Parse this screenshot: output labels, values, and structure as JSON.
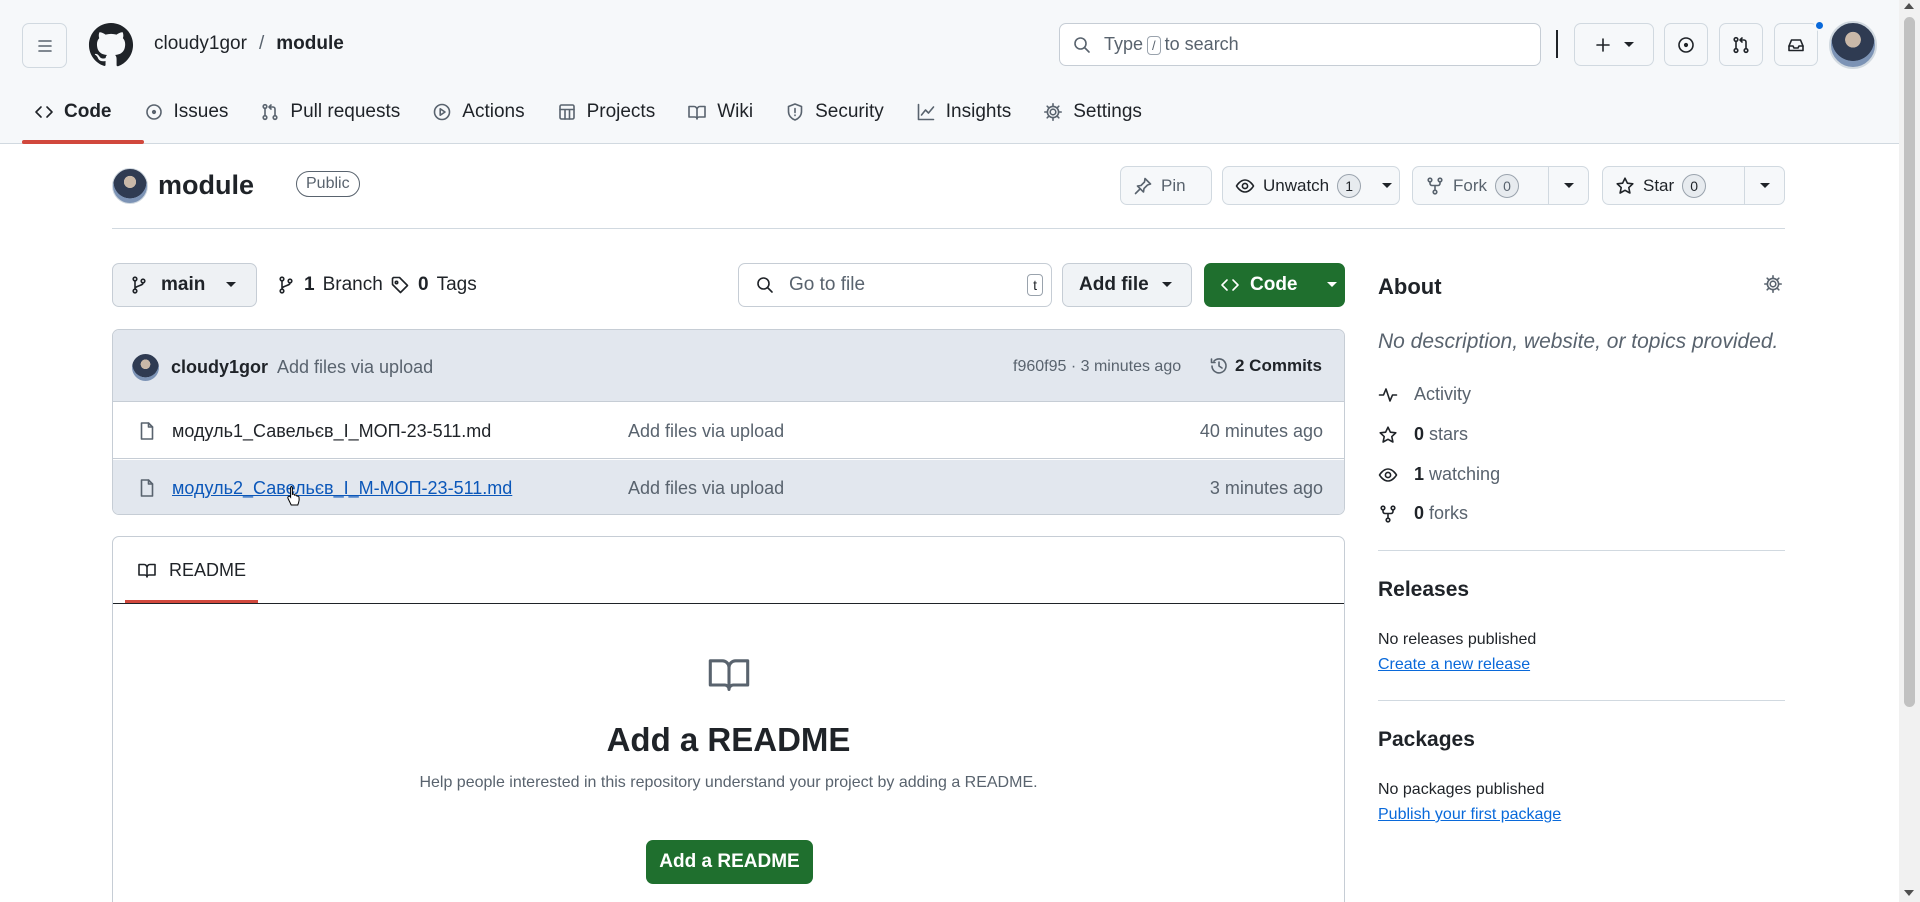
{
  "colors": {
    "accent": "#0969da",
    "primary_button": "#1f6f2e",
    "tab_underline": "#d1483d",
    "header_bg": "#f6f8fa"
  },
  "header": {
    "owner": "cloudy1gor",
    "separator": "/",
    "repo": "module",
    "search_placeholder_before": "Type",
    "search_slash": "/",
    "search_placeholder_after": "to search"
  },
  "tabs": [
    {
      "label": "Code",
      "icon": "code-icon",
      "selected": true
    },
    {
      "label": "Issues",
      "icon": "issue-icon"
    },
    {
      "label": "Pull requests",
      "icon": "pull-request-icon"
    },
    {
      "label": "Actions",
      "icon": "play-icon"
    },
    {
      "label": "Projects",
      "icon": "table-icon"
    },
    {
      "label": "Wiki",
      "icon": "book-icon"
    },
    {
      "label": "Security",
      "icon": "shield-icon"
    },
    {
      "label": "Insights",
      "icon": "graph-icon"
    },
    {
      "label": "Settings",
      "icon": "gear-icon"
    }
  ],
  "repo": {
    "name": "module",
    "visibility": "Public",
    "pin_label": "Pin",
    "unwatch_label": "Unwatch",
    "watch_count": "1",
    "fork_label": "Fork",
    "fork_count": "0",
    "star_label": "Star",
    "star_count": "0"
  },
  "toolbar": {
    "branch": "main",
    "branch_count": "1",
    "branch_label": "Branch",
    "tag_count": "0",
    "tag_label": "Tags",
    "goto_placeholder": "Go to file",
    "goto_key": "t",
    "add_file_label": "Add file",
    "code_label": "Code"
  },
  "latest_commit": {
    "author": "cloudy1gor",
    "message": "Add files via upload",
    "sha_time": "f960f95 · 3 minutes ago",
    "commits_label": "2 Commits"
  },
  "files": [
    {
      "name": "модуль1_Савельєв_І_МОП-23-511.md",
      "message": "Add files via upload",
      "time": "40 minutes ago"
    },
    {
      "name": "модуль2_Савельєв_І_М-МОП-23-511.md",
      "message": "Add files via upload",
      "time": "3 minutes ago"
    }
  ],
  "readme": {
    "tab_label": "README",
    "title": "Add a README",
    "description": "Help people interested in this repository understand your project by adding a README.",
    "button_label": "Add a README"
  },
  "about": {
    "heading": "About",
    "description": "No description, website, or topics provided.",
    "activity_label": "Activity",
    "stars_count": "0",
    "stars_label": "stars",
    "watching_count": "1",
    "watching_label": "watching",
    "forks_count": "0",
    "forks_label": "forks"
  },
  "releases": {
    "heading": "Releases",
    "note": "No releases published",
    "link": "Create a new release"
  },
  "packages": {
    "heading": "Packages",
    "note": "No packages published",
    "link": "Publish your first package"
  }
}
